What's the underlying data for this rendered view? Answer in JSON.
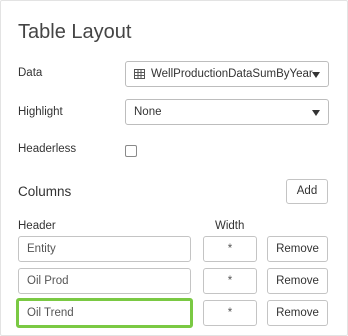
{
  "title": "Table Layout",
  "fields": {
    "data_label": "Data",
    "data_value": "WellProductionDataSumByYear",
    "data_icon": "table-icon",
    "highlight_label": "Highlight",
    "highlight_value": "None",
    "headerless_label": "Headerless",
    "headerless_checked": false
  },
  "columns": {
    "title": "Columns",
    "add_label": "Add",
    "header_col": "Header",
    "width_col": "Width",
    "rows": [
      {
        "header": "Entity",
        "width": "*",
        "remove_label": "Remove"
      },
      {
        "header": "Oil Prod",
        "width": "*",
        "remove_label": "Remove"
      },
      {
        "header": "Oil Trend",
        "width": "*",
        "remove_label": "Remove"
      }
    ]
  },
  "colors": {
    "focus_border": "#7ac943",
    "border": "#c4c4c4",
    "text": "#333333"
  }
}
